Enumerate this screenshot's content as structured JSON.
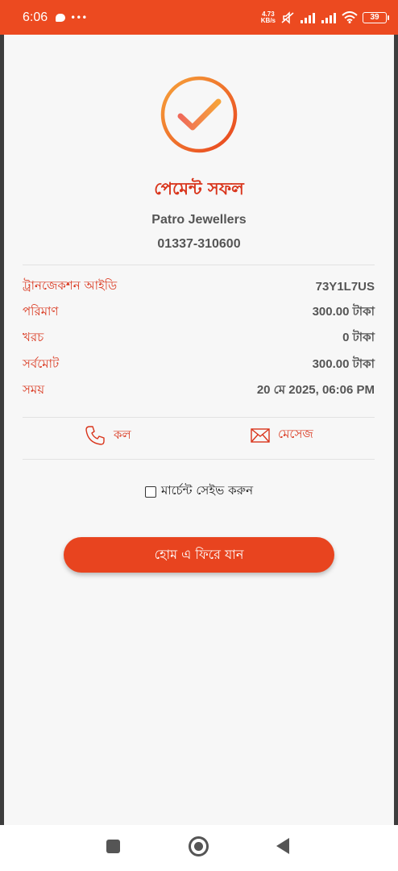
{
  "status_bar": {
    "time": "6:06",
    "net_speed_value": "4.73",
    "net_speed_unit": "KB/s",
    "battery": "39"
  },
  "payment": {
    "title": "পেমেন্ট সফল",
    "merchant_name": "Patro Jewellers",
    "merchant_phone": "01337-310600"
  },
  "details": [
    {
      "label": "ট্রানজেকশন আইডি",
      "value": "73Y1L7US"
    },
    {
      "label": "পরিমাণ",
      "value": "300.00 টাকা"
    },
    {
      "label": "খরচ",
      "value": "0 টাকা"
    },
    {
      "label": "সর্বমোট",
      "value": "300.00 টাকা"
    },
    {
      "label": "সময়",
      "value": "20 মে 2025, 06:06 PM"
    }
  ],
  "actions": {
    "call_label": "কল",
    "message_label": "মেসেজ"
  },
  "save_merchant": {
    "label": "মার্চেন্ট সেইভ করুন",
    "checked": false
  },
  "home_button": {
    "label": "হোম এ ফিরে যান"
  },
  "colors": {
    "accent": "#ec4a20",
    "label_red": "#d9351c",
    "value_gray": "#555555"
  },
  "icons": [
    "chat-bubble-icon",
    "more-icon",
    "mute-icon",
    "signal-icon",
    "wifi-icon",
    "battery-icon",
    "success-check-icon",
    "phone-icon",
    "mail-icon",
    "checkbox-icon",
    "recents-icon",
    "home-icon",
    "back-icon"
  ]
}
